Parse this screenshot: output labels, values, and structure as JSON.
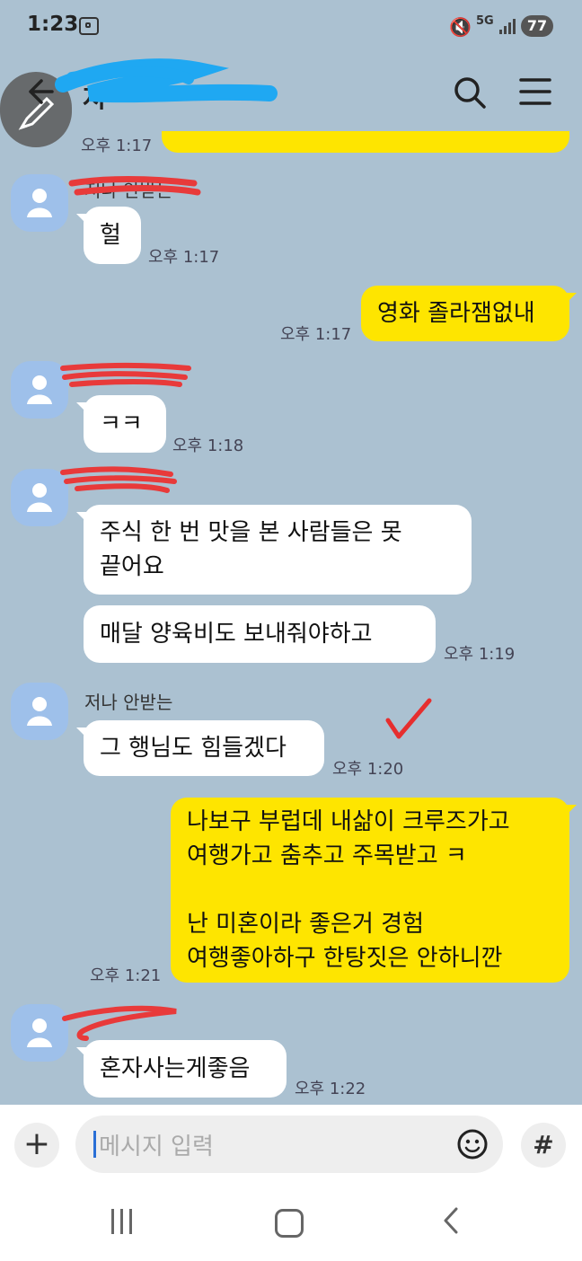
{
  "status_bar": {
    "time": "1:23",
    "network": "5G",
    "battery": "77"
  },
  "header": {
    "title": "저",
    "icons": [
      "back-arrow-icon",
      "search-icon",
      "menu-icon",
      "pen-icon"
    ]
  },
  "messages": {
    "partial_top_time": "오후 1:17",
    "sender_name": "저나 안받는",
    "m1": {
      "text": "헐",
      "time": "오후 1:17"
    },
    "m2": {
      "text": "영화 졸라잼없내",
      "time": "오후 1:17"
    },
    "m3": {
      "text": "ㅋㅋ",
      "time": "오후 1:18"
    },
    "m4": {
      "text": "주식 한 번 맛을 본 사람들은  못\n끝어요"
    },
    "m5": {
      "text": "매달 양육비도 보내줘야하고",
      "time": "오후 1:19"
    },
    "m6": {
      "text": "그 행님도 힘들겠다",
      "time": "오후 1:20"
    },
    "m7": {
      "text": "나보구 부럽데 내삶이 크루즈가고\n여행가고 춤추고 주목받고 ㅋ\n\n난 미혼이라 좋은거 경험\n여행좋아하구 한탕짓은 안하니깐",
      "time": "오후 1:21"
    },
    "m8": {
      "text": "혼자사는게좋음",
      "time": "오후 1:22"
    }
  },
  "input_bar": {
    "placeholder": "메시지 입력",
    "add_label": "+",
    "hash_label": "#"
  },
  "colors": {
    "background": "#abc1d1",
    "my_bubble": "#fee500",
    "their_bubble": "#ffffff",
    "avatar": "#9ec0ea"
  }
}
